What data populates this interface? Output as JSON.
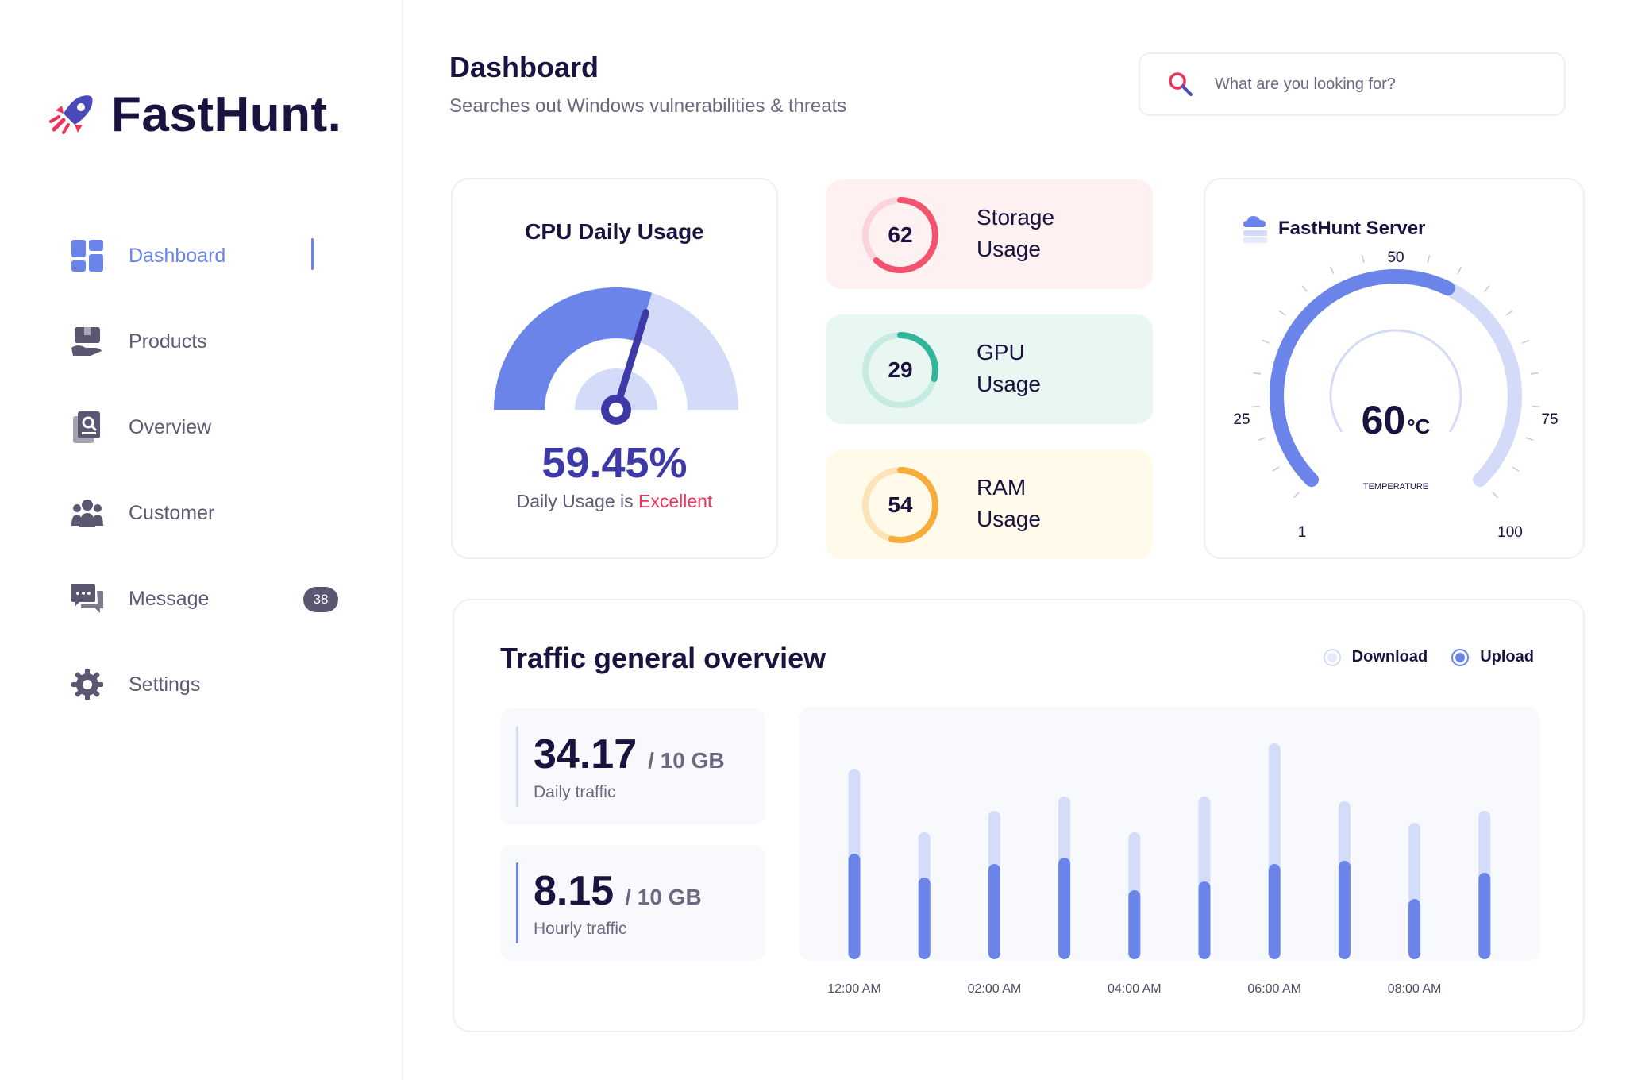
{
  "brand": {
    "name": "FastHunt."
  },
  "nav": {
    "items": [
      {
        "key": "dashboard",
        "label": "Dashboard",
        "icon": "dashboard-icon",
        "active": true
      },
      {
        "key": "products",
        "label": "Products",
        "icon": "products-icon",
        "active": false
      },
      {
        "key": "overview",
        "label": "Overview",
        "icon": "overview-icon",
        "active": false
      },
      {
        "key": "customer",
        "label": "Customer",
        "icon": "customer-icon",
        "active": false
      },
      {
        "key": "message",
        "label": "Message",
        "icon": "message-icon",
        "active": false,
        "badge": "38"
      },
      {
        "key": "settings",
        "label": "Settings",
        "icon": "settings-icon",
        "active": false
      }
    ]
  },
  "header": {
    "title": "Dashboard",
    "subtitle": "Searches out Windows vulnerabilities & threats"
  },
  "search": {
    "placeholder": "What are you looking for?"
  },
  "cpu": {
    "title": "CPU Daily Usage",
    "value": "59.45%",
    "value_fraction": 0.5945,
    "status_prefix": "Daily Usage is",
    "status_word": "Excellent"
  },
  "usage_cards": [
    {
      "key": "storage",
      "value": "62",
      "fraction": 0.62,
      "label_line1": "Storage",
      "label_line2": "Usage",
      "color": "#f2536f",
      "track": "#fbd3da"
    },
    {
      "key": "gpu",
      "value": "29",
      "fraction": 0.29,
      "label_line1": "GPU",
      "label_line2": "Usage",
      "color": "#33b59b",
      "track": "#c7ebe2"
    },
    {
      "key": "ram",
      "value": "54",
      "fraction": 0.54,
      "label_line1": "RAM",
      "label_line2": "Usage",
      "color": "#f6ad3b",
      "track": "#fde3b7"
    }
  ],
  "server": {
    "title": "FastHunt Server",
    "temperature": "60",
    "temperature_unit": "°C",
    "temperature_label": "TEMPERATURE",
    "scale_labels": {
      "min": "1",
      "q1": "25",
      "mid": "50",
      "q3": "75",
      "max": "100"
    },
    "value": 60,
    "min": 1,
    "max": 100
  },
  "traffic": {
    "title": "Traffic general overview",
    "legend": {
      "download": "Download",
      "upload": "Upload",
      "selected": "upload"
    },
    "daily": {
      "value": "34.17",
      "unit": "/ 10 GB",
      "label": "Daily traffic"
    },
    "hourly": {
      "value": "8.15",
      "unit": "/ 10 GB",
      "label": "Hourly traffic"
    }
  },
  "chart_data": {
    "type": "bar",
    "x_tick_labels": [
      "12:00 AM",
      "02:00 AM",
      "04:00 AM",
      "06:00 AM",
      "08:00 AM"
    ],
    "series": [
      {
        "name": "Download",
        "values": [
          240,
          160,
          187,
          205,
          160,
          205,
          272,
          199,
          172,
          187
        ]
      },
      {
        "name": "Upload",
        "values": [
          133,
          103,
          120,
          128,
          87,
          98,
          120,
          124,
          76,
          109
        ]
      }
    ],
    "ylim": [
      0,
      290
    ],
    "colors": {
      "Download": "#d3dcf8",
      "Upload": "#6a84ea"
    }
  },
  "colors": {
    "accent": "#6a84ea",
    "accent_light": "#d3dbf8",
    "highlight": "#f0325a",
    "brand_dark": "#1a1340"
  }
}
